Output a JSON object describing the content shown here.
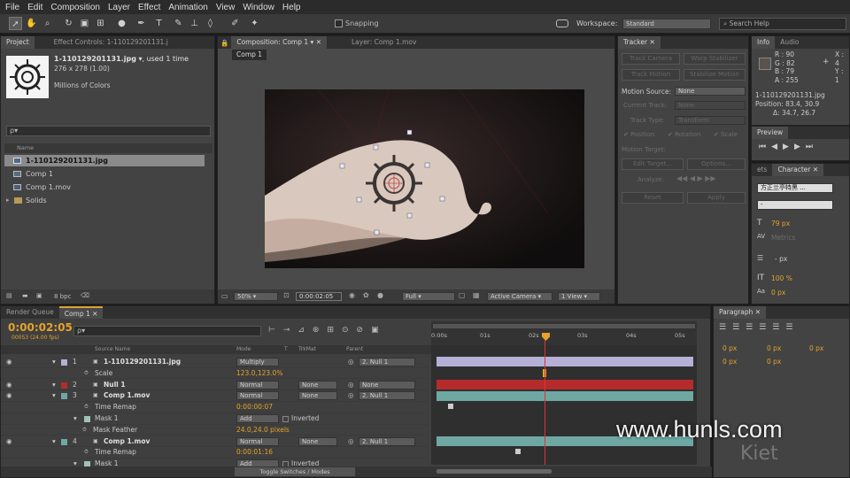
{
  "menu": [
    "File",
    "Edit",
    "Composition",
    "Layer",
    "Effect",
    "Animation",
    "View",
    "Window",
    "Help"
  ],
  "toolbar": {
    "snapping": "Snapping",
    "workspace_label": "Workspace:",
    "workspace_value": "Standard",
    "search_placeholder": "Search Help"
  },
  "project": {
    "tab": "Project",
    "tab2": "Effect Controls: 1-110129201131.j",
    "file_name": "1-110129201131.jpg",
    "used": ", used 1 time",
    "dims": "276 x 278 (1.00)",
    "colors": "Millions of Colors",
    "search": "ρ▾",
    "col_name": "Name",
    "items": [
      "1-110129201131.jpg",
      "Comp 1",
      "Comp 1.mov",
      "Solids"
    ],
    "bpc": "8 bpc"
  },
  "comp": {
    "tab": "Composition: Comp 1",
    "layer_tab": "Layer: Comp 1.mov",
    "crumb": "Comp 1",
    "zoom": "50%",
    "time": "0:00:02:05",
    "quality": "Full",
    "camera": "Active Camera",
    "view": "1 View"
  },
  "tracker": {
    "tab": "Tracker",
    "track_camera": "Track Camera",
    "warp": "Warp Stabilizer",
    "track_motion": "Track Motion",
    "stabilize": "Stabilize Motion",
    "motion_source": "Motion Source:",
    "source_value": "None",
    "current_track": "Current Track:",
    "current_value": "None",
    "track_type": "Track Type:",
    "type_value": "Transform",
    "position": "Position",
    "rotation": "Rotation",
    "scale": "Scale",
    "motion_target": "Motion Target:",
    "edit_target": "Edit Target...",
    "options": "Options...",
    "analyze": "Analyze:",
    "reset": "Reset",
    "apply": "Apply"
  },
  "info": {
    "tab": "Info",
    "tab2": "Audio",
    "r": "R : 90",
    "g": "G : 82",
    "b": "B : 79",
    "a": "A : 255",
    "x": "X : 4",
    "y": "Y : 1",
    "file": "1-110129201131.jpg",
    "pos": "Position: 83.4, 30.9",
    "delta": "Δ: 34.7, 26.7"
  },
  "preview": {
    "tab": "Preview"
  },
  "character": {
    "tab_prefix": "ets",
    "tab": "Character",
    "font": "方正兰亭特黑 ...",
    "style": "-",
    "size": "79 px",
    "metrics": "Metrics",
    "leading": "- px",
    "scale": "100 %",
    "baseline": "0 px"
  },
  "paragraph": {
    "tab": "Paragraph",
    "vals": [
      "0 px",
      "0 px",
      "0 px",
      "0 px",
      "0 px"
    ]
  },
  "timeline": {
    "tab1": "Render Queue",
    "tab2": "Comp 1",
    "time": "0:00:02:05",
    "fps": "00053 (24.00 fps)",
    "search": "ρ▾",
    "cols": {
      "source": "Source Name",
      "mode": "Mode",
      "t": "T",
      "trkmat": "TrkMat",
      "parent": "Parent"
    },
    "ruler": [
      "0:00s",
      "01s",
      "02s",
      "03s",
      "04s",
      "05s"
    ],
    "toggle": "Toggle Switches / Modes",
    "rows": [
      {
        "num": "1",
        "name": "1-110129201131.jpg",
        "mode": "Multiply",
        "trk": "",
        "parent": "2. Null 1",
        "type": "layer"
      },
      {
        "name": "Scale",
        "value": "123.0,123.0%",
        "type": "prop"
      },
      {
        "num": "2",
        "name": "Null 1",
        "mode": "Normal",
        "trk": "None",
        "parent": "None",
        "type": "layer"
      },
      {
        "num": "3",
        "name": "Comp 1.mov",
        "mode": "Normal",
        "trk": "None",
        "parent": "2. Null 1",
        "type": "layer"
      },
      {
        "name": "Time Remap",
        "value": "0:00:00:07",
        "type": "prop"
      },
      {
        "name": "Mask 1",
        "mode": "Add",
        "inv": "Inverted",
        "type": "mask"
      },
      {
        "name": "Mask Feather",
        "value": "24.0,24.0 pixels",
        "type": "prop2"
      },
      {
        "num": "4",
        "name": "Comp 1.mov",
        "mode": "Normal",
        "trk": "None",
        "parent": "2. Null 1",
        "type": "layer"
      },
      {
        "name": "Time Remap",
        "value": "0:00:01:16",
        "type": "prop"
      },
      {
        "name": "Mask 1",
        "mode": "Add",
        "inv": "Inverted",
        "type": "mask"
      }
    ]
  },
  "watermark": {
    "text": "www.hunls.com",
    "logo": "Kiet"
  },
  "colors": {
    "accent": "#e5a32a",
    "panel": "#434343",
    "layer_lilac": "#b4b0d6",
    "layer_red": "#b52b2b",
    "layer_teal": "#6fa7a3"
  }
}
